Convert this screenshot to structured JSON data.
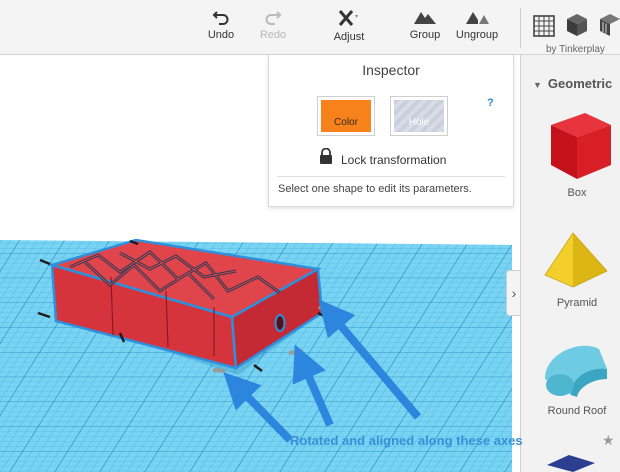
{
  "toolbar": {
    "undo": "Undo",
    "redo": "Redo",
    "adjust": "Adjust",
    "group": "Group",
    "ungroup": "Ungroup",
    "byline": "by Tinkerplay"
  },
  "inspector": {
    "title": "Inspector",
    "color_label": "Color",
    "hole_label": "Hole",
    "help": "?",
    "lock_label": "Lock transformation",
    "hint": "Select one shape to edit its parameters."
  },
  "sidebar": {
    "category": "Geometric",
    "toggle": "›",
    "shapes": [
      {
        "label": "Box",
        "icon": "box-icon"
      },
      {
        "label": "Pyramid",
        "icon": "pyramid-icon"
      },
      {
        "label": "Round Roof",
        "icon": "round-roof-icon"
      }
    ]
  },
  "annotation": "Rotated and aligned along these axes",
  "colors": {
    "grid_blue": "#5ec8ef",
    "shape_red": "#d6343d",
    "selection_outline": "#2e8fdd",
    "orange_swatch": "#f7821b",
    "arrow_blue": "#2d86dd",
    "pyramid_yellow": "#f2cf2a",
    "roof_teal": "#5bbfd6"
  }
}
